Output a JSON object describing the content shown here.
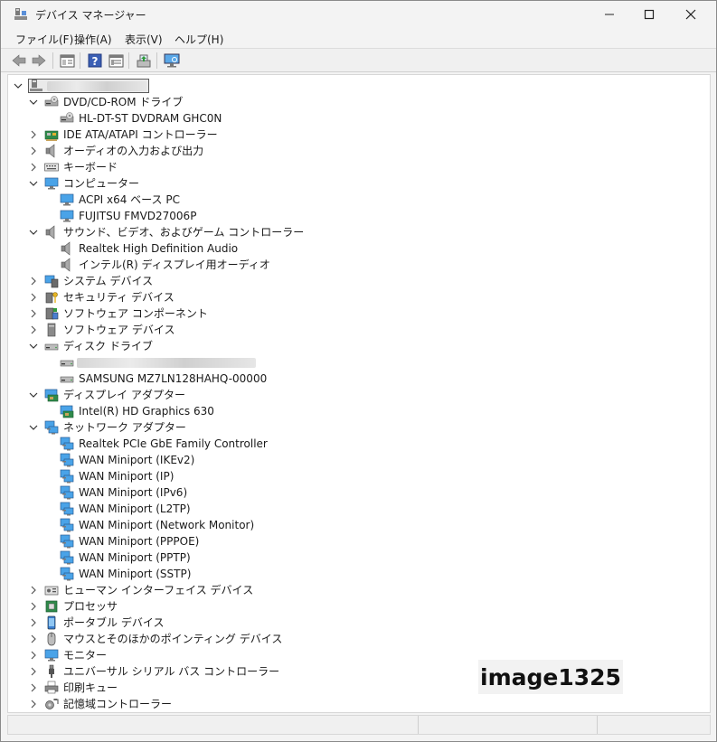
{
  "window": {
    "title": "デバイス マネージャー"
  },
  "menu": [
    {
      "label": "ファイル(F)"
    },
    {
      "label": "操作(A)"
    },
    {
      "label": "表示(V)"
    },
    {
      "label": "ヘルプ(H)"
    }
  ],
  "toolbar": {
    "buttons": [
      "back-icon",
      "forward-icon",
      "properties-view-icon",
      "help-icon",
      "details-view-icon",
      "update-driver-icon",
      "monitor-scan-icon"
    ]
  },
  "tree": [
    {
      "level": 0,
      "expander": "open",
      "icon": "computer-root-icon",
      "label": "",
      "redacted": true
    },
    {
      "level": 1,
      "expander": "open",
      "icon": "dvd-drive-icon",
      "label": "DVD/CD-ROM ドライブ"
    },
    {
      "level": 2,
      "expander": "none",
      "icon": "dvd-drive-icon",
      "label": "HL-DT-ST DVDRAM GHC0N"
    },
    {
      "level": 1,
      "expander": "closed",
      "icon": "ide-controller-icon",
      "label": "IDE ATA/ATAPI コントローラー"
    },
    {
      "level": 1,
      "expander": "closed",
      "icon": "speaker-icon",
      "label": "オーディオの入力および出力"
    },
    {
      "level": 1,
      "expander": "closed",
      "icon": "keyboard-icon",
      "label": "キーボード"
    },
    {
      "level": 1,
      "expander": "open",
      "icon": "monitor-icon",
      "label": "コンピューター"
    },
    {
      "level": 2,
      "expander": "none",
      "icon": "monitor-icon",
      "label": "ACPI x64 ベース PC"
    },
    {
      "level": 2,
      "expander": "none",
      "icon": "monitor-icon",
      "label": "FUJITSU FMVD27006P"
    },
    {
      "level": 1,
      "expander": "open",
      "icon": "speaker-icon",
      "label": "サウンド、ビデオ、およびゲーム コントローラー"
    },
    {
      "level": 2,
      "expander": "none",
      "icon": "speaker-icon",
      "label": "Realtek High Definition Audio"
    },
    {
      "level": 2,
      "expander": "none",
      "icon": "speaker-icon",
      "label": "インテル(R) ディスプレイ用オーディオ"
    },
    {
      "level": 1,
      "expander": "closed",
      "icon": "system-device-icon",
      "label": "システム デバイス"
    },
    {
      "level": 1,
      "expander": "closed",
      "icon": "security-key-icon",
      "label": "セキュリティ デバイス"
    },
    {
      "level": 1,
      "expander": "closed",
      "icon": "software-component-icon",
      "label": "ソフトウェア コンポーネント"
    },
    {
      "level": 1,
      "expander": "closed",
      "icon": "software-device-icon",
      "label": "ソフトウェア デバイス"
    },
    {
      "level": 1,
      "expander": "open",
      "icon": "disk-drive-icon",
      "label": "ディスク ドライブ"
    },
    {
      "level": 2,
      "expander": "none",
      "icon": "disk-drive-icon",
      "label": "",
      "redacted": true
    },
    {
      "level": 2,
      "expander": "none",
      "icon": "disk-drive-icon",
      "label": "SAMSUNG MZ7LN128HAHQ-00000"
    },
    {
      "level": 1,
      "expander": "open",
      "icon": "display-adapter-icon",
      "label": "ディスプレイ アダプター"
    },
    {
      "level": 2,
      "expander": "none",
      "icon": "display-adapter-icon",
      "label": "Intel(R) HD Graphics 630"
    },
    {
      "level": 1,
      "expander": "open",
      "icon": "network-adapter-icon",
      "label": "ネットワーク アダプター"
    },
    {
      "level": 2,
      "expander": "none",
      "icon": "network-adapter-icon",
      "label": "Realtek PCIe GbE Family Controller"
    },
    {
      "level": 2,
      "expander": "none",
      "icon": "network-adapter-icon",
      "label": "WAN Miniport (IKEv2)"
    },
    {
      "level": 2,
      "expander": "none",
      "icon": "network-adapter-icon",
      "label": "WAN Miniport (IP)"
    },
    {
      "level": 2,
      "expander": "none",
      "icon": "network-adapter-icon",
      "label": "WAN Miniport (IPv6)"
    },
    {
      "level": 2,
      "expander": "none",
      "icon": "network-adapter-icon",
      "label": "WAN Miniport (L2TP)"
    },
    {
      "level": 2,
      "expander": "none",
      "icon": "network-adapter-icon",
      "label": "WAN Miniport (Network Monitor)"
    },
    {
      "level": 2,
      "expander": "none",
      "icon": "network-adapter-icon",
      "label": "WAN Miniport (PPPOE)"
    },
    {
      "level": 2,
      "expander": "none",
      "icon": "network-adapter-icon",
      "label": "WAN Miniport (PPTP)"
    },
    {
      "level": 2,
      "expander": "none",
      "icon": "network-adapter-icon",
      "label": "WAN Miniport (SSTP)"
    },
    {
      "level": 1,
      "expander": "closed",
      "icon": "hid-icon",
      "label": "ヒューマン インターフェイス デバイス"
    },
    {
      "level": 1,
      "expander": "closed",
      "icon": "processor-icon",
      "label": "プロセッサ"
    },
    {
      "level": 1,
      "expander": "closed",
      "icon": "portable-device-icon",
      "label": "ポータブル デバイス"
    },
    {
      "level": 1,
      "expander": "closed",
      "icon": "mouse-icon",
      "label": "マウスとそのほかのポインティング デバイス"
    },
    {
      "level": 1,
      "expander": "closed",
      "icon": "monitor-icon",
      "label": "モニター"
    },
    {
      "level": 1,
      "expander": "closed",
      "icon": "usb-icon",
      "label": "ユニバーサル シリアル バス コントローラー"
    },
    {
      "level": 1,
      "expander": "closed",
      "icon": "printer-icon",
      "label": "印刷キュー"
    },
    {
      "level": 1,
      "expander": "closed",
      "icon": "storage-controller-icon",
      "label": "記憶域コントローラー"
    }
  ],
  "watermark": "image1325"
}
